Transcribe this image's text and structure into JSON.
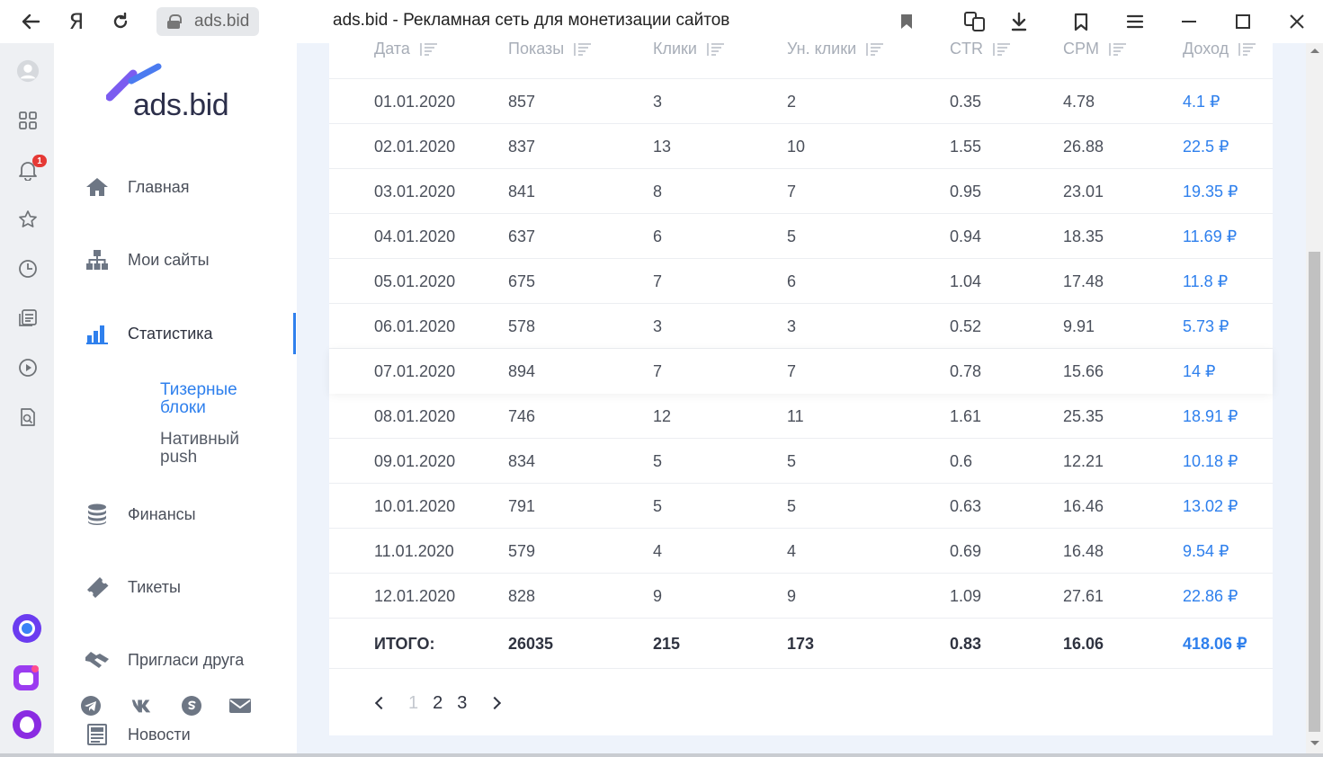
{
  "browser": {
    "domain": "ads.bid",
    "title": "ads.bid - Рекламная сеть для монетизации сайтов",
    "yandex_glyph": "Я"
  },
  "rail": {
    "notification_count": "1"
  },
  "logo": {
    "text": "ads.bid"
  },
  "nav": {
    "home": "Главная",
    "sites": "Мои сайты",
    "stats": "Статистика",
    "sub_teaser": "Тизерные блоки",
    "sub_native": "Нативный push",
    "finance": "Финансы",
    "tickets": "Тикеты",
    "invite": "Пригласи друга",
    "news": "Новости"
  },
  "table": {
    "headers": [
      "Дата",
      "Показы",
      "Клики",
      "Ун. клики",
      "CTR",
      "CPM",
      "Доход"
    ],
    "rows": [
      [
        "01.01.2020",
        "857",
        "3",
        "2",
        "0.35",
        "4.78",
        "4.1 ₽"
      ],
      [
        "02.01.2020",
        "837",
        "13",
        "10",
        "1.55",
        "26.88",
        "22.5 ₽"
      ],
      [
        "03.01.2020",
        "841",
        "8",
        "7",
        "0.95",
        "23.01",
        "19.35 ₽"
      ],
      [
        "04.01.2020",
        "637",
        "6",
        "5",
        "0.94",
        "18.35",
        "11.69 ₽"
      ],
      [
        "05.01.2020",
        "675",
        "7",
        "6",
        "1.04",
        "17.48",
        "11.8 ₽"
      ],
      [
        "06.01.2020",
        "578",
        "3",
        "3",
        "0.52",
        "9.91",
        "5.73 ₽"
      ],
      [
        "07.01.2020",
        "894",
        "7",
        "7",
        "0.78",
        "15.66",
        "14 ₽"
      ],
      [
        "08.01.2020",
        "746",
        "12",
        "11",
        "1.61",
        "25.35",
        "18.91 ₽"
      ],
      [
        "09.01.2020",
        "834",
        "5",
        "5",
        "0.6",
        "12.21",
        "10.18 ₽"
      ],
      [
        "10.01.2020",
        "791",
        "5",
        "5",
        "0.63",
        "16.46",
        "13.02 ₽"
      ],
      [
        "11.01.2020",
        "579",
        "4",
        "4",
        "0.69",
        "16.48",
        "9.54 ₽"
      ],
      [
        "12.01.2020",
        "828",
        "9",
        "9",
        "1.09",
        "27.61",
        "22.86 ₽"
      ]
    ],
    "total": [
      "ИТОГО:",
      "26035",
      "215",
      "173",
      "0.83",
      "16.06",
      "418.06 ₽"
    ]
  },
  "pager": {
    "pages": [
      "1",
      "2",
      "3"
    ],
    "current": "1"
  },
  "colors": {
    "accent": "#2f80ed",
    "text": "#4a4f5a",
    "header": "#a7adb7"
  }
}
